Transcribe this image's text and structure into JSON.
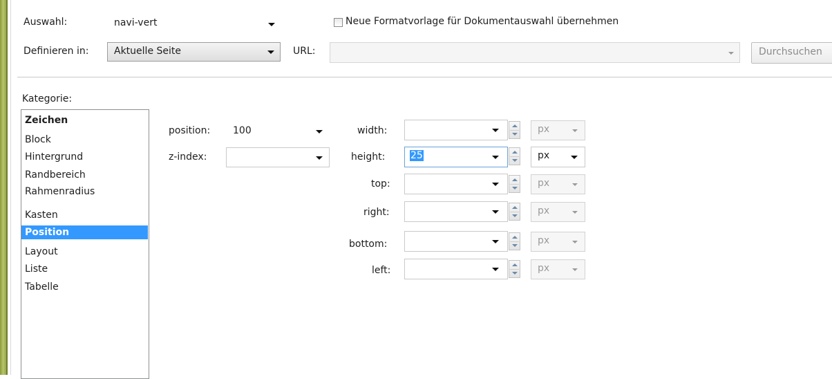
{
  "header": {
    "auswahl_label": "Auswahl:",
    "auswahl_value": "navi-vert",
    "checkbox_label": "Neue Formatvorlage für Dokumentauswahl übernehmen",
    "definieren_label": "Definieren in:",
    "definieren_value": "Aktuelle Seite",
    "url_label": "URL:",
    "url_value": "",
    "durchsuchen_label": "Durchsuchen"
  },
  "kategorie": {
    "label": "Kategorie:",
    "items": [
      "Zeichen",
      "Block",
      "Hintergrund",
      "Randbereich",
      "Rahmenradius",
      "Kasten",
      "Position",
      "Layout",
      "Liste",
      "Tabelle"
    ],
    "selected": "Position"
  },
  "fields": {
    "position_label": "position:",
    "position_value": "100",
    "zindex_label": "z-index:",
    "zindex_value": "",
    "width_label": "width:",
    "height_label": "height:",
    "height_value": "25",
    "top_label": "top:",
    "right_label": "right:",
    "bottom_label": "bottom:",
    "left_label": "left:",
    "unit": "px"
  }
}
